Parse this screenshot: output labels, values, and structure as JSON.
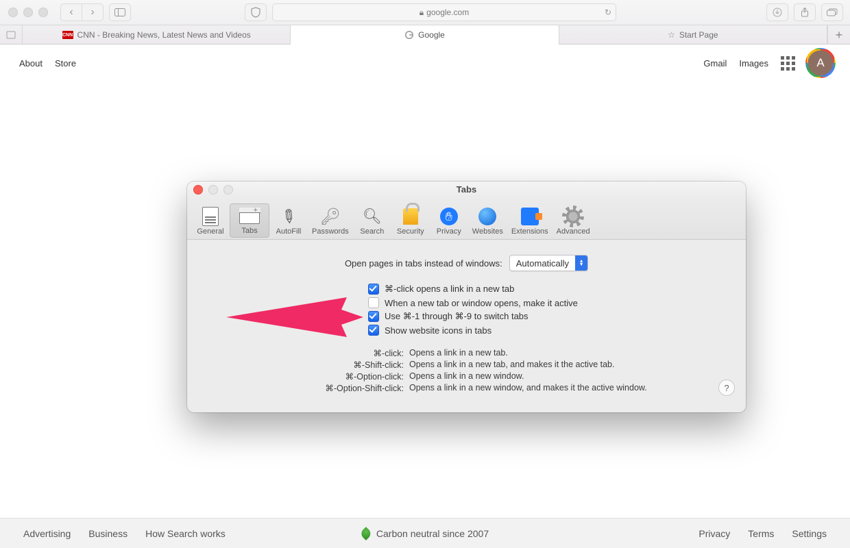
{
  "browser": {
    "address": "google.com",
    "tabs": [
      {
        "label": "CNN - Breaking News, Latest News and Videos",
        "icon": "cnn"
      },
      {
        "label": "Google",
        "icon": "google",
        "active": true
      },
      {
        "label": "Start Page",
        "icon": "star"
      }
    ]
  },
  "google": {
    "header": {
      "about": "About",
      "store": "Store",
      "gmail": "Gmail",
      "images": "Images",
      "avatar_letter": "A"
    },
    "footer": {
      "advertising": "Advertising",
      "business": "Business",
      "how": "How Search works",
      "carbon": "Carbon neutral since 2007",
      "privacy": "Privacy",
      "terms": "Terms",
      "settings": "Settings"
    }
  },
  "prefs": {
    "title": "Tabs",
    "toolbar": [
      "General",
      "Tabs",
      "AutoFill",
      "Passwords",
      "Search",
      "Security",
      "Privacy",
      "Websites",
      "Extensions",
      "Advanced"
    ],
    "active_tab": "Tabs",
    "open_label": "Open pages in tabs instead of windows:",
    "open_value": "Automatically",
    "checks": [
      {
        "checked": true,
        "label": "⌘-click opens a link in a new tab"
      },
      {
        "checked": false,
        "label": "When a new tab or window opens, make it active"
      },
      {
        "checked": true,
        "label": "Use ⌘-1 through ⌘-9 to switch tabs"
      },
      {
        "checked": true,
        "label": "Show website icons in tabs"
      }
    ],
    "hints": [
      {
        "k": "⌘-click:",
        "v": "Opens a link in a new tab."
      },
      {
        "k": "⌘-Shift-click:",
        "v": "Opens a link in a new tab, and makes it the active tab."
      },
      {
        "k": "⌘-Option-click:",
        "v": "Opens a link in a new window."
      },
      {
        "k": "⌘-Option-Shift-click:",
        "v": "Opens a link in a new window, and makes it the active window."
      }
    ]
  }
}
